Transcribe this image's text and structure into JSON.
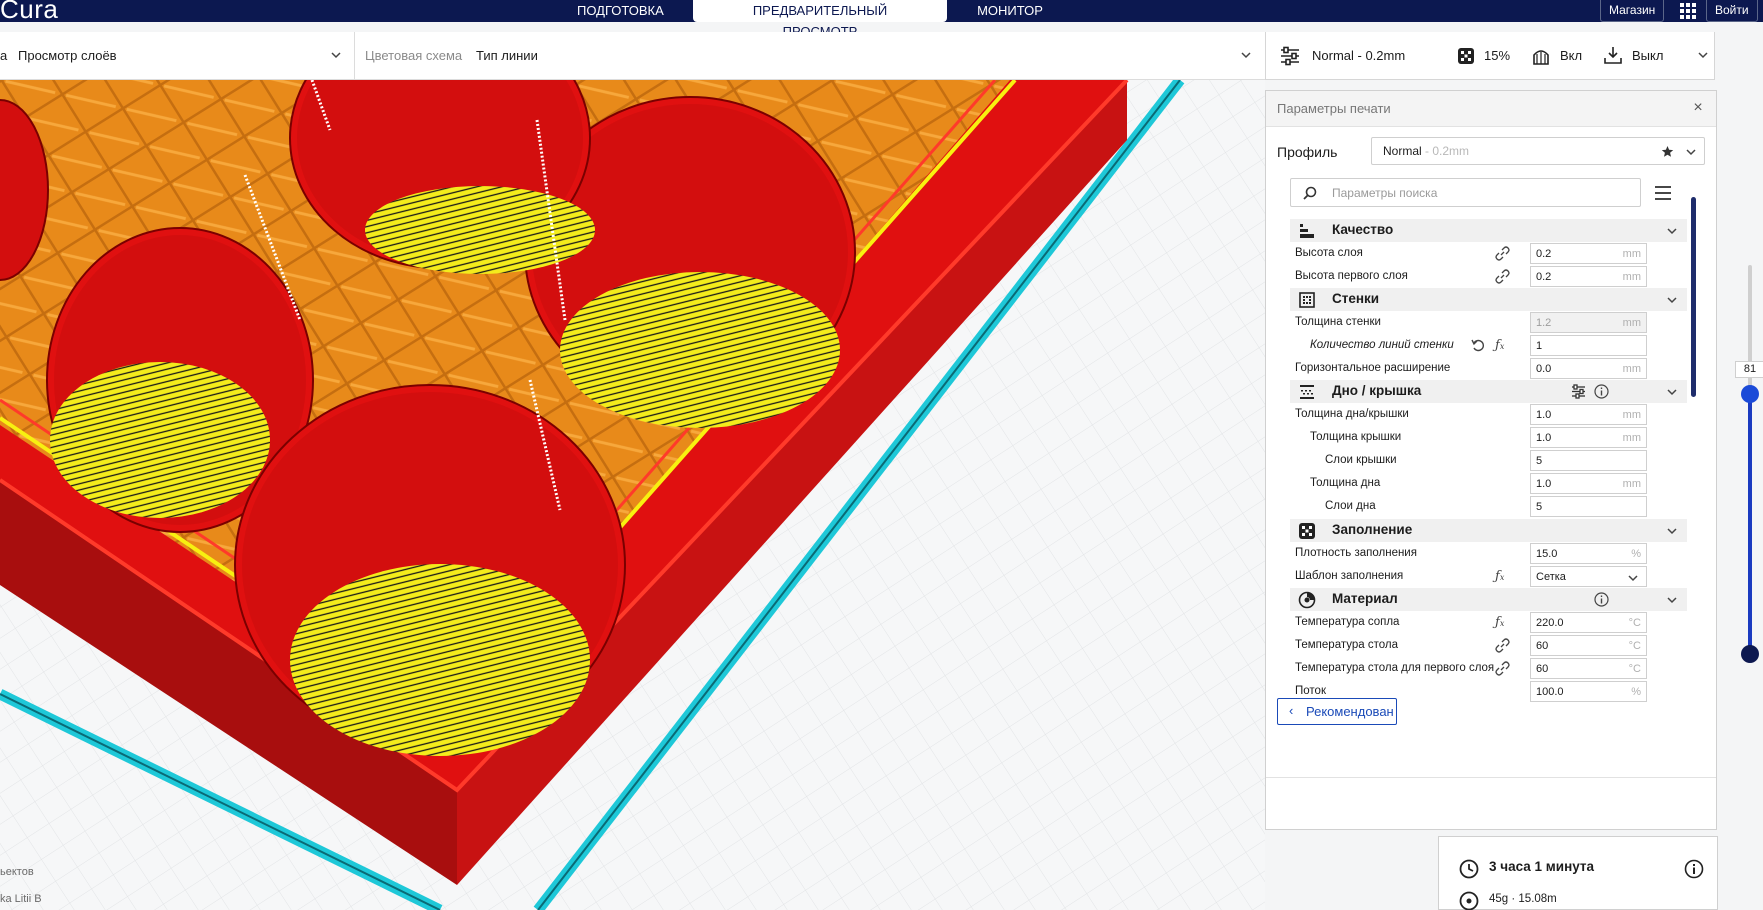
{
  "app": {
    "brand": "Cura",
    "stages": [
      "ПОДГОТОВКА",
      "ПРЕДВАРИТЕЛЬНЫЙ ПРОСМОТР",
      "МОНИТОР"
    ],
    "active_stage": "ПРЕДВАРИТЕЛЬНЫЙ ПРОСМОТР",
    "marketplace": "Магазин",
    "login": "Войти"
  },
  "viewbar": {
    "view_prefix": "а",
    "view_value": "Просмотр слоёв",
    "color_scheme_label": "Цветовая схема",
    "color_scheme_value": "Тип линии"
  },
  "printbar": {
    "profile": "Normal - 0.2mm",
    "infill": "15%",
    "support": "Вкл",
    "adhesion": "Выкл"
  },
  "panel": {
    "title": "Параметры печати",
    "profile_label": "Профиль",
    "profile_name": "Normal",
    "profile_suffix": " - 0.2mm",
    "search_placeholder": "Параметры поиска",
    "recommended_button": "Рекомендован"
  },
  "settings": {
    "categories": {
      "quality": "Качество",
      "walls": "Стенки",
      "topbottom": "Дно / крышка",
      "infill": "Заполнение",
      "material": "Материал"
    },
    "rows": [
      {
        "label": "Высота слоя",
        "value": "0.2",
        "unit": "mm"
      },
      {
        "label": "Высота первого слоя",
        "value": "0.2",
        "unit": "mm"
      },
      {
        "label": "Толщина стенки",
        "value": "1.2",
        "unit": "mm"
      },
      {
        "label": "Количество линий стенки",
        "value": "1",
        "unit": ""
      },
      {
        "label": "Горизонтальное расширение",
        "value": "0.0",
        "unit": "mm"
      },
      {
        "label": "Толщина дна/крышки",
        "value": "1.0",
        "unit": "mm"
      },
      {
        "label": "Толщина крышки",
        "value": "1.0",
        "unit": "mm"
      },
      {
        "label": "Слои крышки",
        "value": "5",
        "unit": ""
      },
      {
        "label": "Толщина дна",
        "value": "1.0",
        "unit": "mm"
      },
      {
        "label": "Слои дна",
        "value": "5",
        "unit": ""
      },
      {
        "label": "Плотность заполнения",
        "value": "15.0",
        "unit": "%"
      },
      {
        "label": "Шаблон заполнения",
        "value": "Сетка",
        "unit": ""
      },
      {
        "label": "Температура сопла",
        "value": "220.0",
        "unit": "°C"
      },
      {
        "label": "Температура стола",
        "value": "60",
        "unit": "°C"
      },
      {
        "label": "Температура стола для первого слоя",
        "value": "60",
        "unit": "°C"
      },
      {
        "label": "Поток",
        "value": "100.0",
        "unit": "%"
      }
    ]
  },
  "viewport": {
    "footer_line1": "ьектов",
    "footer_line2": "ka Litii B"
  },
  "slider": {
    "layer": "81",
    "max_fraction": 0.33
  },
  "print_info": {
    "time": "3 часа 1 минута",
    "material": "45g · 15.08m"
  },
  "colors": {
    "header": "#0c1850",
    "wall": "#e01010",
    "infill": "#f0901c",
    "skin": "#f4ec1c",
    "skirt": "#1ec8d8",
    "accent": "#1a4ab8"
  }
}
